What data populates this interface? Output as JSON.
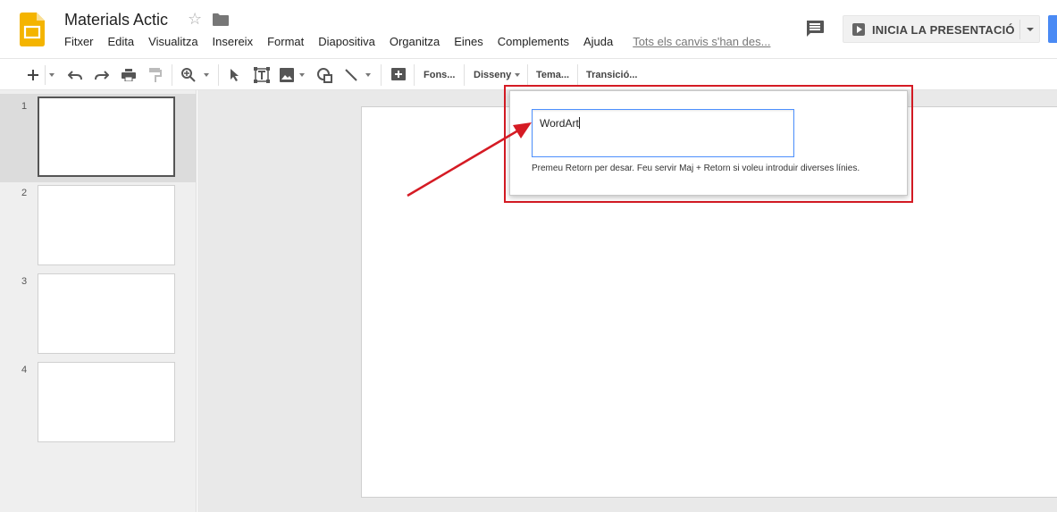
{
  "app": {
    "title": "Materials Actic",
    "logo_icon": "google-slides-icon",
    "star_icon": "star-outline-icon",
    "folder_icon": "folder-icon",
    "brand_color": "#f4b400"
  },
  "menu": {
    "items": [
      "Fitxer",
      "Edita",
      "Visualitza",
      "Insereix",
      "Format",
      "Diapositiva",
      "Organitza",
      "Eines",
      "Complements",
      "Ajuda"
    ],
    "save_status": "Tots els canvis s'han des..."
  },
  "header": {
    "comments_icon": "comment-icon",
    "present_label": "INICIA LA PRESENTACIÓ",
    "share_color": "#4a8af4"
  },
  "toolbar": {
    "icons": [
      "plus-icon",
      "undo-icon",
      "redo-icon",
      "print-icon",
      "paint-format-icon",
      "zoom-icon",
      "select-cursor-icon",
      "text-box-icon",
      "image-icon",
      "shape-icon",
      "line-icon",
      "add-comment-icon"
    ],
    "background_label": "Fons...",
    "layout_label": "Disseny",
    "theme_label": "Tema...",
    "transition_label": "Transició..."
  },
  "filmstrip": {
    "slides": [
      {
        "number": "1",
        "selected": true
      },
      {
        "number": "2",
        "selected": false
      },
      {
        "number": "3",
        "selected": false
      },
      {
        "number": "4",
        "selected": false
      }
    ]
  },
  "wordart_dialog": {
    "input_value": "WordArt",
    "hint": "Premeu Retorn per desar. Feu servir Maj + Retorn si voleu introduir diverses línies.",
    "annotation_color": "#d51b24"
  }
}
